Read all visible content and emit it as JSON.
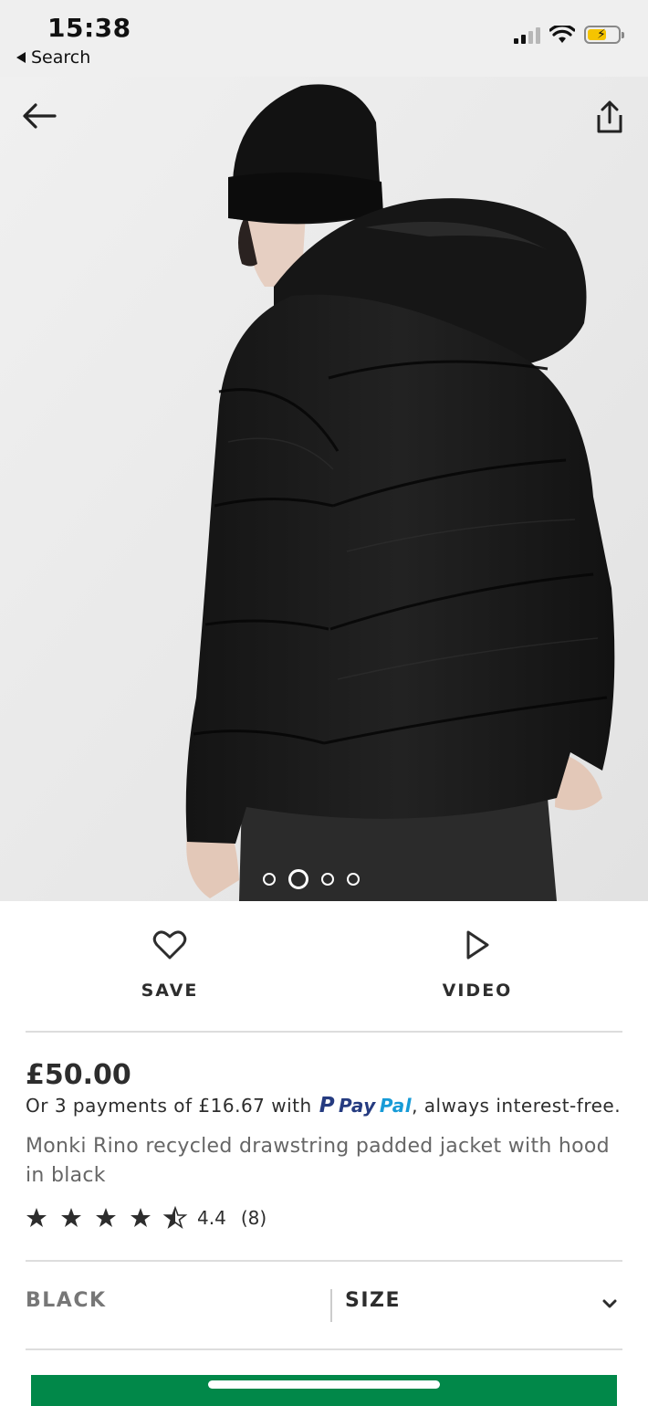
{
  "status_bar": {
    "time": "15:38",
    "back_app_label": "Search",
    "icons": [
      "signal-icon",
      "wifi-icon",
      "battery-charging-icon"
    ]
  },
  "hero": {
    "image_description_icon": "product-photo",
    "carousel": {
      "count": 4,
      "active_index": 1
    }
  },
  "actions": {
    "save_label": "SAVE",
    "video_label": "VIDEO"
  },
  "product": {
    "price": "£50.00",
    "installments_prefix": "Or 3 payments of £16.67 with",
    "paypal_pay": "Pay",
    "paypal_pal": "Pal",
    "installments_suffix": ", always interest-free.",
    "title": "Monki Rino recycled drawstring padded jacket with hood in black",
    "rating_value": "4.4",
    "rating_count": "(8)",
    "rating_stars": 4.5
  },
  "selectors": {
    "colour": "BLACK",
    "size_label": "SIZE"
  },
  "colors": {
    "accent_green": "#018849",
    "text": "#2d2d2d",
    "muted": "#666666",
    "paypal_dark": "#253b80",
    "paypal_light": "#179bd7"
  }
}
